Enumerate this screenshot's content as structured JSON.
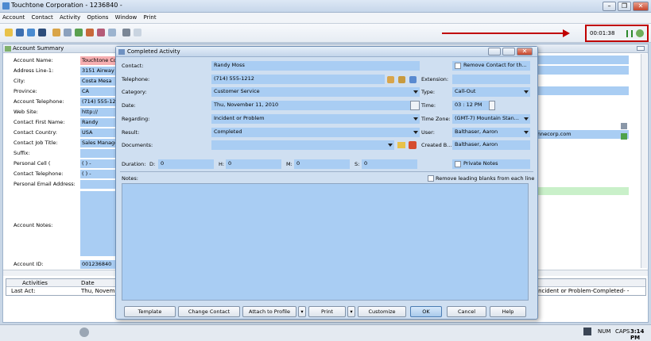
{
  "window": {
    "title": "Touchtone Corporation - 1236840 -"
  },
  "menu": [
    "Account",
    "Contact",
    "Activity",
    "Options",
    "Window",
    "Print"
  ],
  "timer": {
    "value": "00:01:38"
  },
  "account_summary": {
    "title": "Account Summary",
    "fields": [
      {
        "label": "Account Name:",
        "value": "Touchtone Co"
      },
      {
        "label": "Address Line-1:",
        "value": "3151 Airway A"
      },
      {
        "label": "City:",
        "value": "Costa Mesa"
      },
      {
        "label": "Province:",
        "value": "CA"
      },
      {
        "label": "Account Telephone:",
        "value": "(714) 555-12"
      },
      {
        "label": "Web Site:",
        "value": "http://"
      },
      {
        "label": "Contact First Name:",
        "value": "Randy"
      },
      {
        "label": "Contact Country:",
        "value": "USA"
      },
      {
        "label": "Contact Job Title:",
        "value": "Sales Manage"
      },
      {
        "label": "Suffix:",
        "value": ""
      },
      {
        "label": "Personal Cell (",
        "value": "(  )  -"
      },
      {
        "label": "Contact Telephone:",
        "value": "(  )  -"
      },
      {
        "label": "Personal Email Address:",
        "value": ""
      }
    ],
    "notes_label": "Account Notes:",
    "account_id_label": "Account ID:",
    "account_id_value": "001236840",
    "right_email_fragment": "nnecorp.com",
    "activities_header": [
      "Activities",
      "Date"
    ],
    "last_act_label": "Last Act:",
    "last_act_date": "Thu, Novembe",
    "last_act_summary": "Incident or Problem-Completed- -"
  },
  "dialog": {
    "title": "Completed Activity",
    "contact_label": "Contact:",
    "contact_value": "Randy Moss",
    "remove_contact_label": "Remove Contact for th...",
    "telephone_label": "Telephone:",
    "telephone_value": "(714) 555-1212",
    "extension_label": "Extension:",
    "category_label": "Category:",
    "category_value": "Customer Service",
    "type_label": "Type:",
    "type_value": "Call-Out",
    "date_label": "Date:",
    "date_value": "Thu, November 11, 2010",
    "time_label": "Time:",
    "time_value": "03 : 12   PM",
    "regarding_label": "Regarding:",
    "regarding_value": "Incident or Problem",
    "timezone_label": "Time Zone:",
    "timezone_value": "(GMT-7) Mountain Stan...",
    "result_label": "Result:",
    "result_value": "Completed",
    "user_label": "User:",
    "user_value": "Balthaser, Aaron",
    "documents_label": "Documents:",
    "created_by_label": "Created B...",
    "created_by_value": "Balthaser, Aaron",
    "duration_label": "Duration:",
    "duration": {
      "D": "0",
      "H": "0",
      "M": "0",
      "S": "0"
    },
    "d_label": "D:",
    "h_label": "H:",
    "m_label": "M:",
    "s_label": "S:",
    "private_notes_label": "Private Notes",
    "notes_label": "Notes:",
    "remove_blanks_label": "Remove leading blanks from each line",
    "buttons": {
      "template": "Template",
      "change_contact": "Change Contact",
      "attach_to_profile": "Attach to Profile",
      "print": "Print",
      "customize": "Customize",
      "ok": "OK",
      "cancel": "Cancel",
      "help": "Help"
    }
  },
  "status": {
    "num": "NUM",
    "caps": "CAPS",
    "time": "3:14 PM"
  },
  "colors": {
    "field_blue": "#a9cdf3",
    "field_pink": "#f6aeb0",
    "annotation_red": "#c00000"
  }
}
